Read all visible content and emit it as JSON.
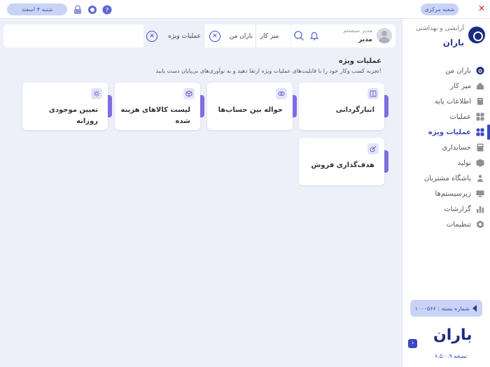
{
  "topbar": {
    "date": "شنبه ۴ اسفند",
    "branch": "شعبه مرکزی",
    "icons": [
      "lock-icon",
      "headset-icon",
      "help-icon"
    ],
    "close": "✕"
  },
  "sidebar": {
    "brand_subtitle": "آرایشی و بهداشتی",
    "brand_name": "باران",
    "items": [
      {
        "label": "باران من",
        "icon": "baran-icon",
        "active": false
      },
      {
        "label": "میز کار",
        "icon": "desk-icon",
        "active": false
      },
      {
        "label": "اطلاعات پایه",
        "icon": "info-icon",
        "active": false
      },
      {
        "label": "عملیات",
        "icon": "operations-icon",
        "active": false
      },
      {
        "label": "عملیات ویژه",
        "icon": "special-operations-icon",
        "active": true
      },
      {
        "label": "حسابداری",
        "icon": "accounting-icon",
        "active": false
      },
      {
        "label": "تولید",
        "icon": "production-icon",
        "active": false
      },
      {
        "label": "باشگاه مشتریان",
        "icon": "customers-club-icon",
        "active": false
      },
      {
        "label": "زیرسیستم‌ها",
        "icon": "subsystems-icon",
        "active": false
      },
      {
        "label": "گزارشات",
        "icon": "reports-icon",
        "active": false
      },
      {
        "label": "تنظیمات",
        "icon": "settings-icon",
        "active": false
      }
    ],
    "package_label": "شماره بسته : ۱۰۰۰۵۶۶",
    "logo_text": "باران",
    "version": "نسخه ۶.۵.۰.۹"
  },
  "header": {
    "user_role": "مدیر سیستم",
    "user_name": "مدیر",
    "tabs": [
      {
        "label": "میز کار",
        "closable": false
      },
      {
        "label": "باران من",
        "closable": true
      },
      {
        "label": "عملیات ویژه",
        "closable": true
      }
    ]
  },
  "main": {
    "title": "عملیات ویژه",
    "description": "تجربه کسب وکار خود را با قابلیت‌های عملیات ویژه ارتقا دهید و به نوآوری‌های بی‌پایان دست یابید!",
    "cards": [
      {
        "label": "انبارگردانی",
        "icon": "inventory-icon"
      },
      {
        "label": "حواله بین حساب‌ها",
        "icon": "transfer-icon"
      },
      {
        "label": "لیست کالاهای هزینه شده",
        "icon": "box-icon"
      },
      {
        "label": "تعیین موجودی روزانه",
        "icon": "sun-icon"
      },
      {
        "label": "هدف‌گذاری فروش",
        "icon": "target-icon"
      }
    ]
  },
  "colors": {
    "accent": "#3b48c2",
    "brand_dark": "#1c2a80",
    "card_tab": "#7f6de0",
    "background": "#eef0f9",
    "close": "#d8222a"
  }
}
